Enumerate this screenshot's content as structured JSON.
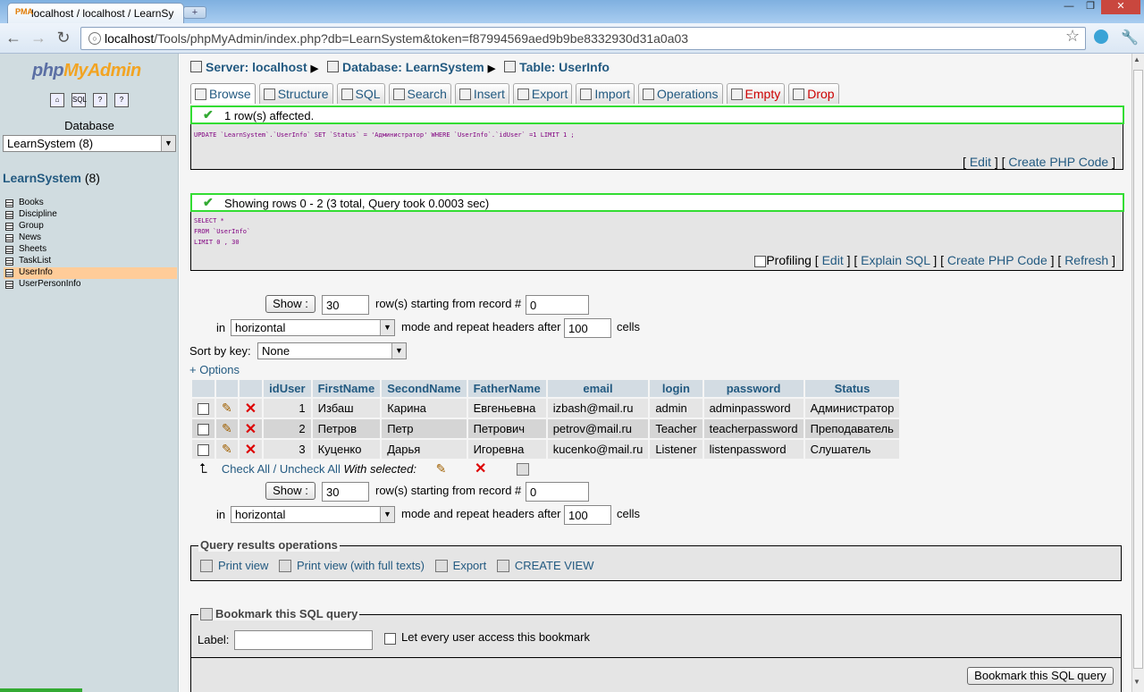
{
  "browser": {
    "tab_title": "localhost / localhost / LearnSy",
    "tab_favicon": "PMA",
    "address_host": "localhost",
    "address_path": "/Tools/phpMyAdmin/index.php?db=LearnSystem&token=f87994569aed9b9be8332930d31a0a03"
  },
  "sidebar": {
    "logo_php": "php",
    "logo_myadmin": "MyAdmin",
    "database_label": "Database",
    "database_select": "LearnSystem (8)",
    "db_name": "LearnSystem",
    "db_count": " (8)",
    "tables": [
      "Books",
      "Discipline",
      "Group",
      "News",
      "Sheets",
      "TaskList",
      "UserInfo",
      "UserPersonInfo"
    ],
    "active_table": "UserInfo"
  },
  "breadcrumb": {
    "server": "Server: localhost",
    "database": "Database: LearnSystem",
    "table": "Table: UserInfo"
  },
  "tabs": [
    "Browse",
    "Structure",
    "SQL",
    "Search",
    "Insert",
    "Export",
    "Import",
    "Operations",
    "Empty",
    "Drop"
  ],
  "update_box": {
    "message": "1 row(s) affected.",
    "sql": "UPDATE `LearnSystem`.`UserInfo` SET `Status` = 'Администратор' WHERE `UserInfo`.`idUser` =1 LIMIT 1 ;",
    "edit": "Edit",
    "create_php": "Create PHP Code"
  },
  "select_box": {
    "message": "Showing rows 0 - 2 (3 total, Query took 0.0003 sec)",
    "sql_line1": "SELECT *",
    "sql_line2": "FROM `UserInfo`",
    "sql_line3": "LIMIT 0 , 30",
    "profiling": "Profiling",
    "edit": "Edit",
    "explain": "Explain SQL",
    "create_php": "Create PHP Code",
    "refresh": "Refresh"
  },
  "nav": {
    "show_button": "Show :",
    "rows_value": "30",
    "rows_text": "row(s) starting from record #",
    "start_value": "0",
    "in_text": "in",
    "mode_value": "horizontal",
    "repeat_text": "mode and repeat headers after",
    "repeat_value": "100",
    "cells_text": "cells"
  },
  "sort": {
    "label": "Sort by key:",
    "value": "None"
  },
  "options_link": "+ Options",
  "table": {
    "columns": [
      "idUser",
      "FirstName",
      "SecondName",
      "FatherName",
      "email",
      "login",
      "password",
      "Status"
    ],
    "rows": [
      [
        "1",
        "Избаш",
        "Карина",
        "Евгеньевна",
        "izbash@mail.ru",
        "admin",
        "adminpassword",
        "Администратор"
      ],
      [
        "2",
        "Петров",
        "Петр",
        "Петрович",
        "petrov@mail.ru",
        "Teacher",
        "teacherpassword",
        "Преподаватель"
      ],
      [
        "3",
        "Куценко",
        "Дарья",
        "Игоревна",
        "kucenko@mail.ru",
        "Listener",
        "listenpassword",
        "Слушатель"
      ]
    ]
  },
  "with_selected": {
    "check_all": "Check All",
    "sep": " / ",
    "uncheck_all": "Uncheck All",
    "label": "With selected:"
  },
  "query_ops": {
    "legend": "Query results operations",
    "print_view": "Print view",
    "print_full": "Print view (with full texts)",
    "export": "Export",
    "create_view": "CREATE VIEW"
  },
  "bookmark": {
    "legend": "Bookmark this SQL query",
    "label": "Label:",
    "every_user": "Let every user access this bookmark",
    "button": "Bookmark this SQL query"
  }
}
